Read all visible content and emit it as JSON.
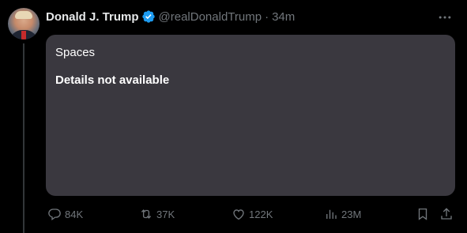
{
  "tweet": {
    "author_name": "Donald J. Trump",
    "handle": "@realDonaldTrump",
    "separator": "·",
    "time": "34m"
  },
  "card": {
    "label": "Spaces",
    "title": "Details not available"
  },
  "actions": {
    "replies": "84K",
    "reposts": "37K",
    "likes": "122K",
    "views": "23M"
  },
  "colors": {
    "background": "#000000",
    "card_background": "#3a383f",
    "verified_badge": "#1d9bf0",
    "muted_text": "#71767b"
  },
  "icons": [
    "verified-badge-icon",
    "more-icon",
    "reply-icon",
    "repost-icon",
    "like-icon",
    "views-icon",
    "bookmark-icon",
    "share-icon"
  ]
}
